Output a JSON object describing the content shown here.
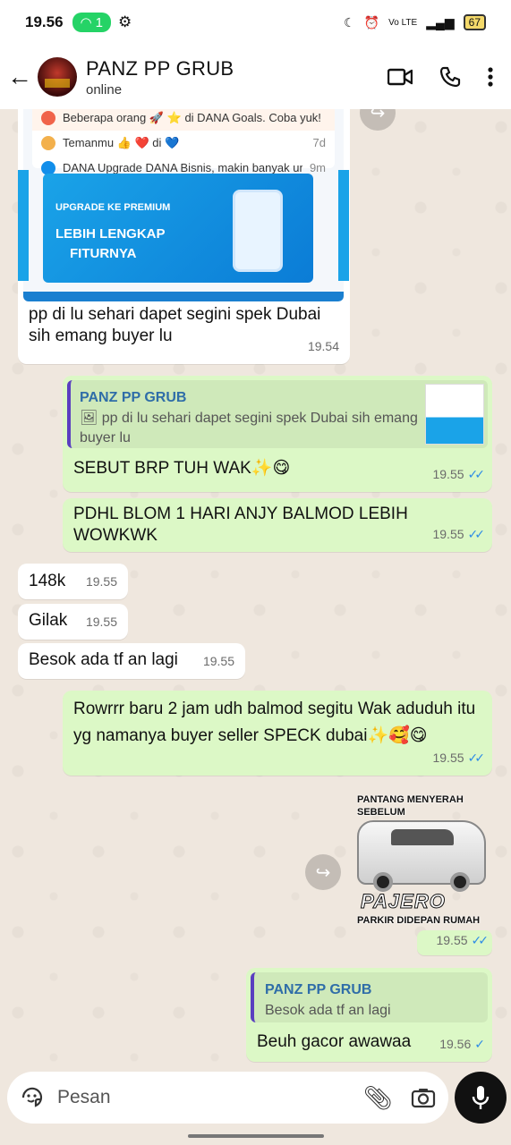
{
  "status": {
    "time": "19.56",
    "hotspot_count": "1",
    "battery": "67"
  },
  "header": {
    "title": "PANZ PP GRUB",
    "subtitle": "online"
  },
  "image_card": {
    "rows": [
      {
        "text": "Beberapa orang 🚀 ⭐ di DANA Goals. Coba yuk!",
        "right": ""
      },
      {
        "text": "Temanmu 👍 ❤️ di 💙",
        "right": "7d"
      },
      {
        "text": "DANA Upgrade DANA Bisnis, makin banyak unt...",
        "right": "9m"
      }
    ],
    "banner_chip": "UPGRADE KE PREMIUM",
    "banner_line1": "LEBIH LENGKAP",
    "banner_line2": "FITURNYA"
  },
  "messages": {
    "m1": {
      "text": "pp di lu sehari dapet segini spek Dubai sih emang buyer lu",
      "time": "19.54"
    },
    "m2": {
      "quote_name": "PANZ PP GRUB",
      "quote_text": "🖼 pp di lu sehari dapet segini spek Dubai sih emang buyer lu",
      "text": "SEBUT BRP TUH WAK✨😋",
      "time": "19.55"
    },
    "m3": {
      "text": "PDHL BLOM 1 HARI ANJY BALMOD LEBIH WOWKWK",
      "time": "19.55"
    },
    "m4": {
      "text": "148k",
      "time": "19.55"
    },
    "m5": {
      "text": "Gilak",
      "time": "19.55"
    },
    "m6": {
      "text": "Besok ada tf an lagi",
      "time": "19.55"
    },
    "m7": {
      "text": "Rowrrr baru 2 jam udh balmod segitu Wak aduduh itu yg namanya buyer seller SPECK dubai✨🥰😋",
      "time": "19.55"
    },
    "m8": {
      "sticker_top": "PANTANG MENYERAH SEBELUM",
      "sticker_brand": "PAJERO",
      "sticker_bottom": "PARKIR DIDEPAN RUMAH",
      "time": "19.55"
    },
    "m9": {
      "quote_name": "PANZ PP GRUB",
      "quote_text": "Besok ada tf an lagi",
      "text": "Beuh gacor awawaa",
      "time": "19.56"
    }
  },
  "input": {
    "placeholder": "Pesan"
  },
  "colors": {
    "outgoing": "#dcf8c6",
    "incoming": "#ffffff",
    "read_ticks": "#2e8ce6",
    "hotspot": "#25d366"
  }
}
